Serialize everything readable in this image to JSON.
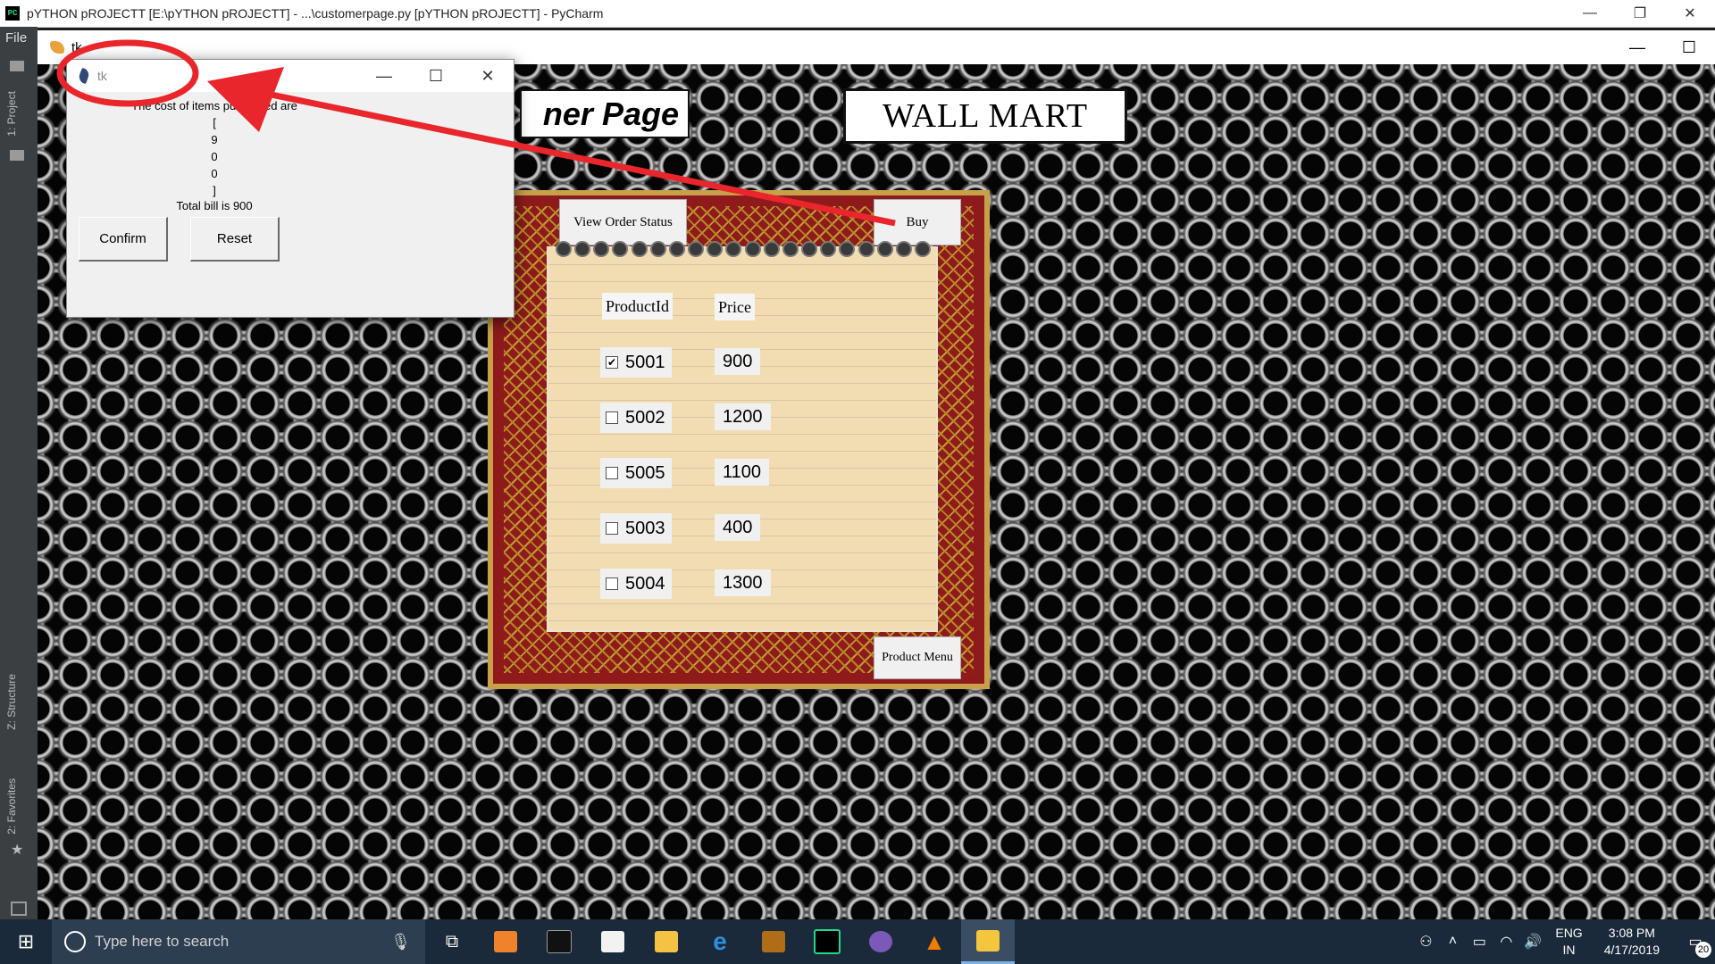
{
  "pycharm": {
    "window_title": "pYTHON pROJECTT [E:\\pYTHON pROJECTT] - ...\\customerpage.py [pYTHON pROJECTT] - PyCharm",
    "menu_file": "File",
    "tab_project": "1: Project",
    "tab_structure": "Z: Structure",
    "tab_favorites": "2: Favorites",
    "controls": {
      "minimize": "—",
      "restore": "❐",
      "close": "✕"
    }
  },
  "main_window": {
    "title": "tk",
    "page_title": "ner Page",
    "brand": "WALL MART",
    "buttons": {
      "view_order_status": "View Order Status",
      "buy": "Buy",
      "product_menu": "Product Menu"
    },
    "table": {
      "header_product": "ProductId",
      "header_price": "Price",
      "rows": [
        {
          "id": "5001",
          "price": "900",
          "checked": true
        },
        {
          "id": "5002",
          "price": "1200",
          "checked": false
        },
        {
          "id": "5005",
          "price": "1100",
          "checked": false
        },
        {
          "id": "5003",
          "price": "400",
          "checked": false
        },
        {
          "id": "5004",
          "price": "1300",
          "checked": false
        }
      ]
    }
  },
  "popup": {
    "title": "tk",
    "line1": "The cost of items purchased are",
    "bracket_open": "[",
    "item1": "9",
    "item2": "0",
    "item3": "0",
    "bracket_close": "]",
    "total": "Total bill is 900",
    "confirm": "Confirm",
    "reset": "Reset"
  },
  "taskbar": {
    "search_placeholder": "Type here to search",
    "lang_top": "ENG",
    "lang_bottom": "IN",
    "time": "3:08 PM",
    "date": "4/17/2019",
    "notification_count": "20"
  },
  "colors": {
    "frame_red": "#8e1a1c",
    "annotation_red": "#e8262b",
    "taskbar": "#1a2a3a"
  }
}
